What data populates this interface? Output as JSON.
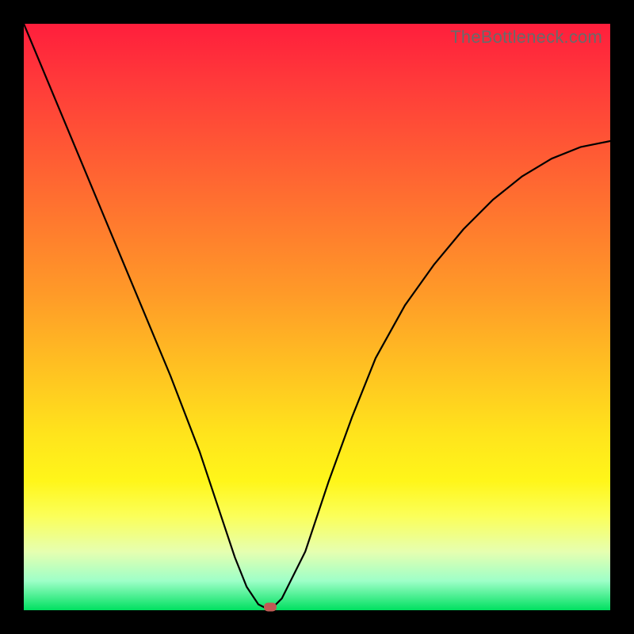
{
  "watermark": "TheBottleneck.com",
  "chart_data": {
    "type": "line",
    "title": "",
    "xlabel": "",
    "ylabel": "",
    "xlim": [
      0,
      100
    ],
    "ylim": [
      0,
      100
    ],
    "grid": false,
    "legend": false,
    "series": [
      {
        "name": "curve",
        "x": [
          0,
          5,
          10,
          15,
          20,
          25,
          30,
          33,
          36,
          38,
          40,
          42,
          44,
          48,
          52,
          56,
          60,
          65,
          70,
          75,
          80,
          85,
          90,
          95,
          100
        ],
        "y": [
          100,
          88,
          76,
          64,
          52,
          40,
          27,
          18,
          9,
          4,
          1,
          0,
          2,
          10,
          22,
          33,
          43,
          52,
          59,
          65,
          70,
          74,
          77,
          79,
          80
        ]
      }
    ],
    "markers": [
      {
        "name": "min-point",
        "x": 42,
        "y": 0
      }
    ],
    "background_gradient": {
      "top": "#ff1e3c",
      "bottom": "#00e060"
    }
  }
}
